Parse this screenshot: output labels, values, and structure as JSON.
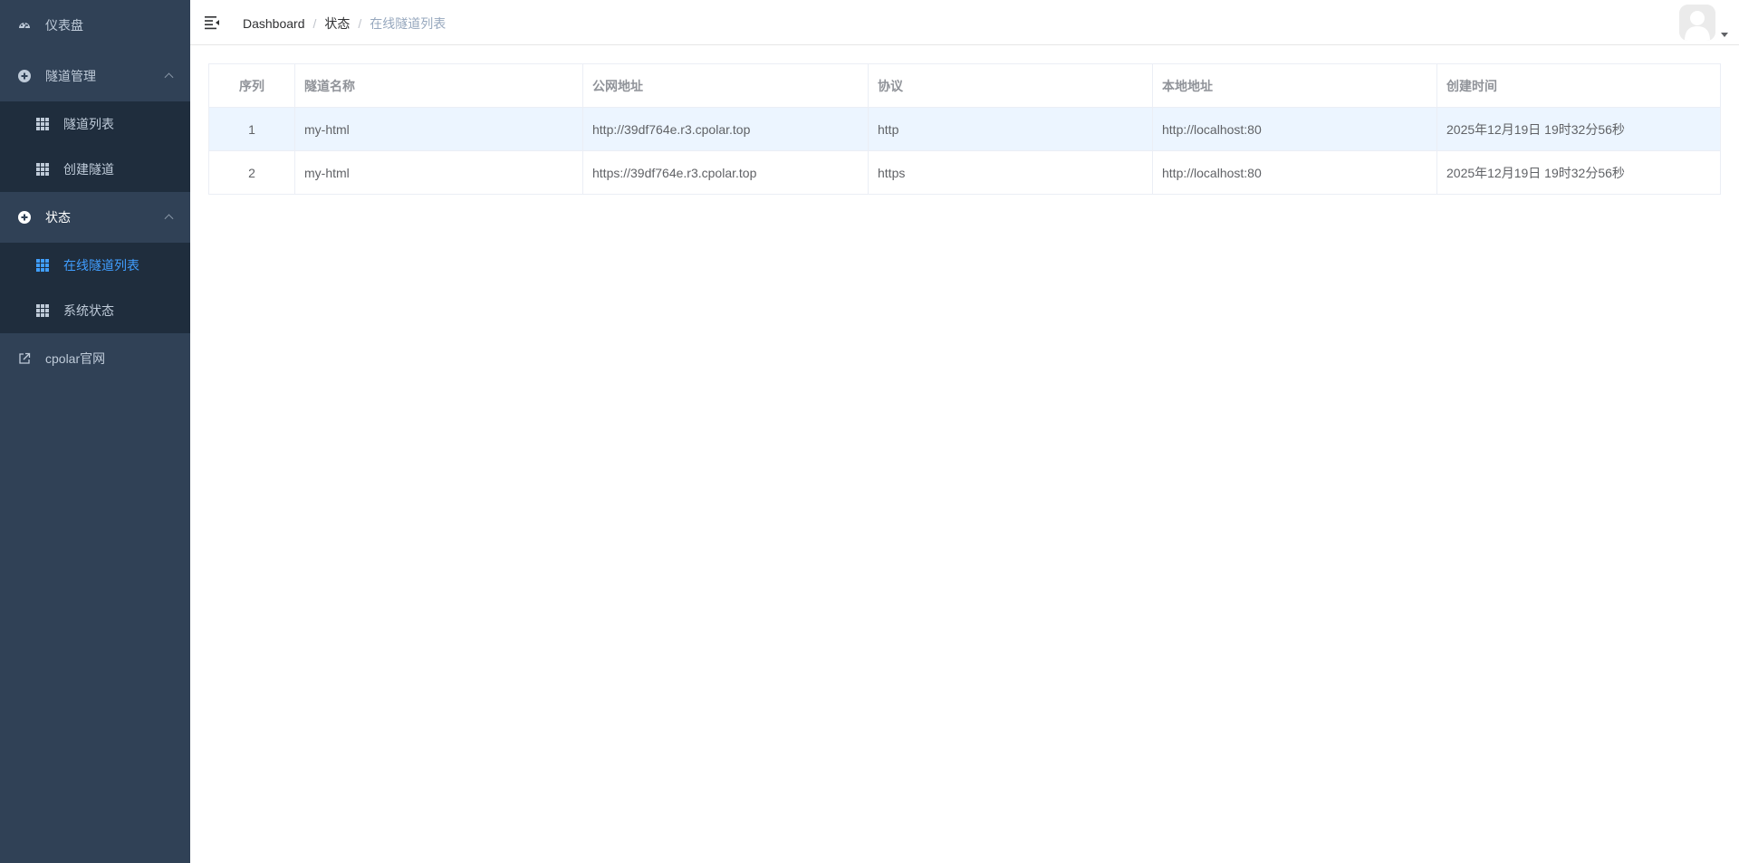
{
  "sidebar": {
    "dashboard": {
      "label": "仪表盘",
      "icon": "dashboard-icon"
    },
    "tunnel_mgmt": {
      "label": "隧道管理",
      "icon": "plus-circle-icon",
      "items": [
        {
          "label": "隧道列表",
          "icon": "table-icon"
        },
        {
          "label": "创建隧道",
          "icon": "table-icon"
        }
      ]
    },
    "status": {
      "label": "状态",
      "icon": "plus-circle-icon",
      "items": [
        {
          "label": "在线隧道列表",
          "icon": "table-icon",
          "active": true
        },
        {
          "label": "系统状态",
          "icon": "table-icon"
        }
      ]
    },
    "website": {
      "label": "cpolar官网",
      "icon": "external-link-icon"
    }
  },
  "header": {
    "breadcrumb": [
      "Dashboard",
      "状态",
      "在线隧道列表"
    ]
  },
  "table": {
    "columns": [
      "序列",
      "隧道名称",
      "公网地址",
      "协议",
      "本地地址",
      "创建时间"
    ],
    "rows": [
      [
        "1",
        "my-html",
        "http://39df764e.r3.cpolar.top",
        "http",
        "http://localhost:80",
        "2025年12月19日 19时32分56秒"
      ],
      [
        "2",
        "my-html",
        "https://39df764e.r3.cpolar.top",
        "https",
        "http://localhost:80",
        "2025年12月19日 19时32分56秒"
      ]
    ]
  },
  "colors": {
    "sidebar_bg": "#304156",
    "submenu_bg": "#1f2d3d",
    "active": "#409eff",
    "highlight_row": "#ecf5ff"
  }
}
